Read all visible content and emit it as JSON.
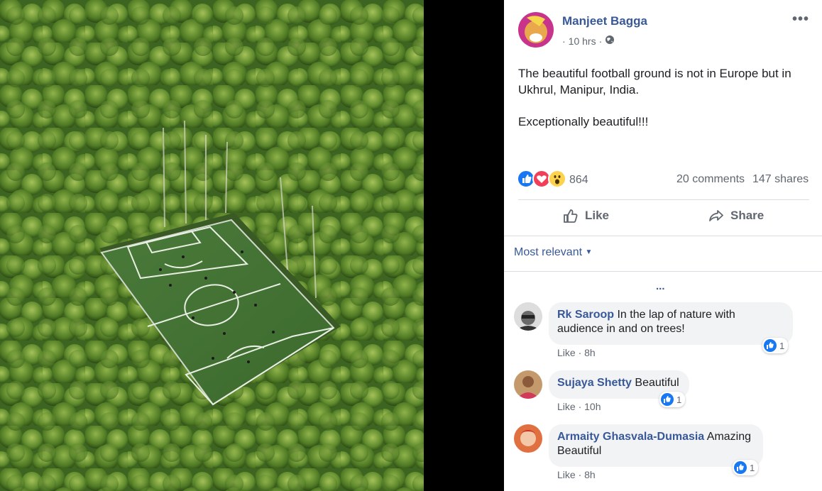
{
  "post": {
    "author": "Manjeet Bagga",
    "time": "10 hrs",
    "time_prefix": "·",
    "time_sep": "·",
    "text_line1": "The beautiful football ground is not in Europe but in Ukhrul, Manipur, India.",
    "text_line2": "Exceptionally beautiful!!!",
    "reaction_count": "864",
    "comments": "20 comments",
    "shares": "147 shares",
    "like_label": "Like",
    "share_label": "Share",
    "more_icon": "more-options-icon"
  },
  "comments_section": {
    "sort_label": "Most relevant",
    "more_dots": "...",
    "comments": [
      {
        "name": "Rk Saroop",
        "text": "In the lap of nature with audience in and on trees!",
        "like": "Like",
        "sep": "·",
        "time": "8h",
        "reactions": "1"
      },
      {
        "name": "Sujaya Shetty",
        "text": "Beautiful",
        "like": "Like",
        "sep": "·",
        "time": "10h",
        "reactions": "1"
      },
      {
        "name": "Armaity Ghasvala-Dumasia",
        "text": "Amazing Beautiful",
        "like": "Like",
        "sep": "·",
        "time": "8h",
        "reactions": "1"
      }
    ]
  },
  "colors": {
    "link": "#385898",
    "like_blue": "#1877f2",
    "love_red": "#f33e58",
    "wow_yellow": "#fcd34d"
  }
}
